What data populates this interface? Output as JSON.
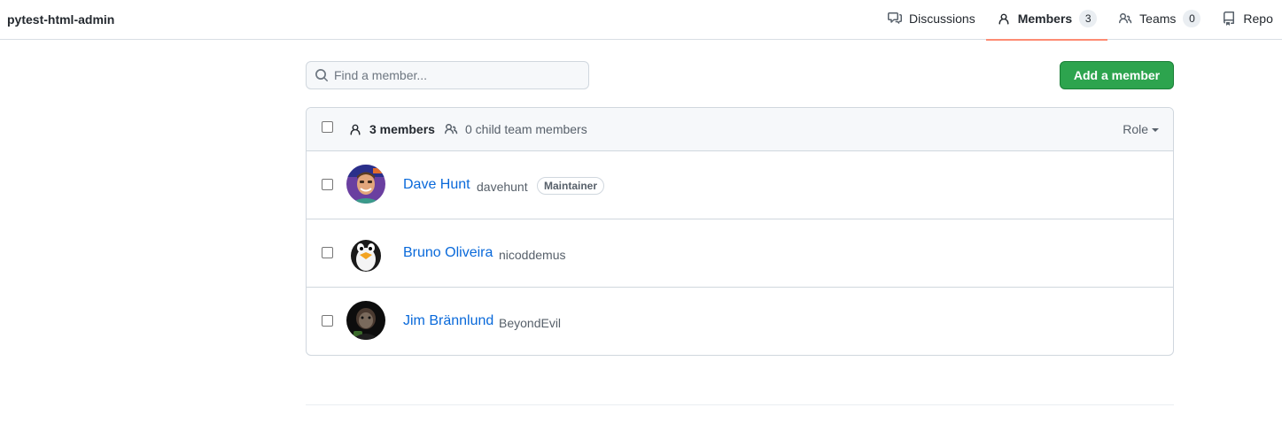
{
  "header": {
    "team_name": "pytest-html-admin",
    "tabs": [
      {
        "label": "Discussions",
        "icon": "comment-discussion-icon"
      },
      {
        "label": "Members",
        "icon": "person-icon",
        "count": "3",
        "selected": true
      },
      {
        "label": "Teams",
        "icon": "people-icon",
        "count": "0"
      },
      {
        "label": "Repo",
        "icon": "repo-icon"
      }
    ]
  },
  "search": {
    "placeholder": "Find a member...",
    "value": ""
  },
  "add_member_label": "Add a member",
  "list_header": {
    "members_count": "3 members",
    "child_members": "0 child team members",
    "role_label": "Role"
  },
  "members": [
    {
      "name": "Dave Hunt",
      "login": "davehunt",
      "badge": "Maintainer"
    },
    {
      "name": "Bruno Oliveira",
      "login": "nicoddemus"
    },
    {
      "name": "Jim Brännlund",
      "login": "BeyondEvil"
    }
  ],
  "colors": {
    "accent_underline": "#fd8c73",
    "primary_button": "#2da44e",
    "link": "#0969da"
  }
}
